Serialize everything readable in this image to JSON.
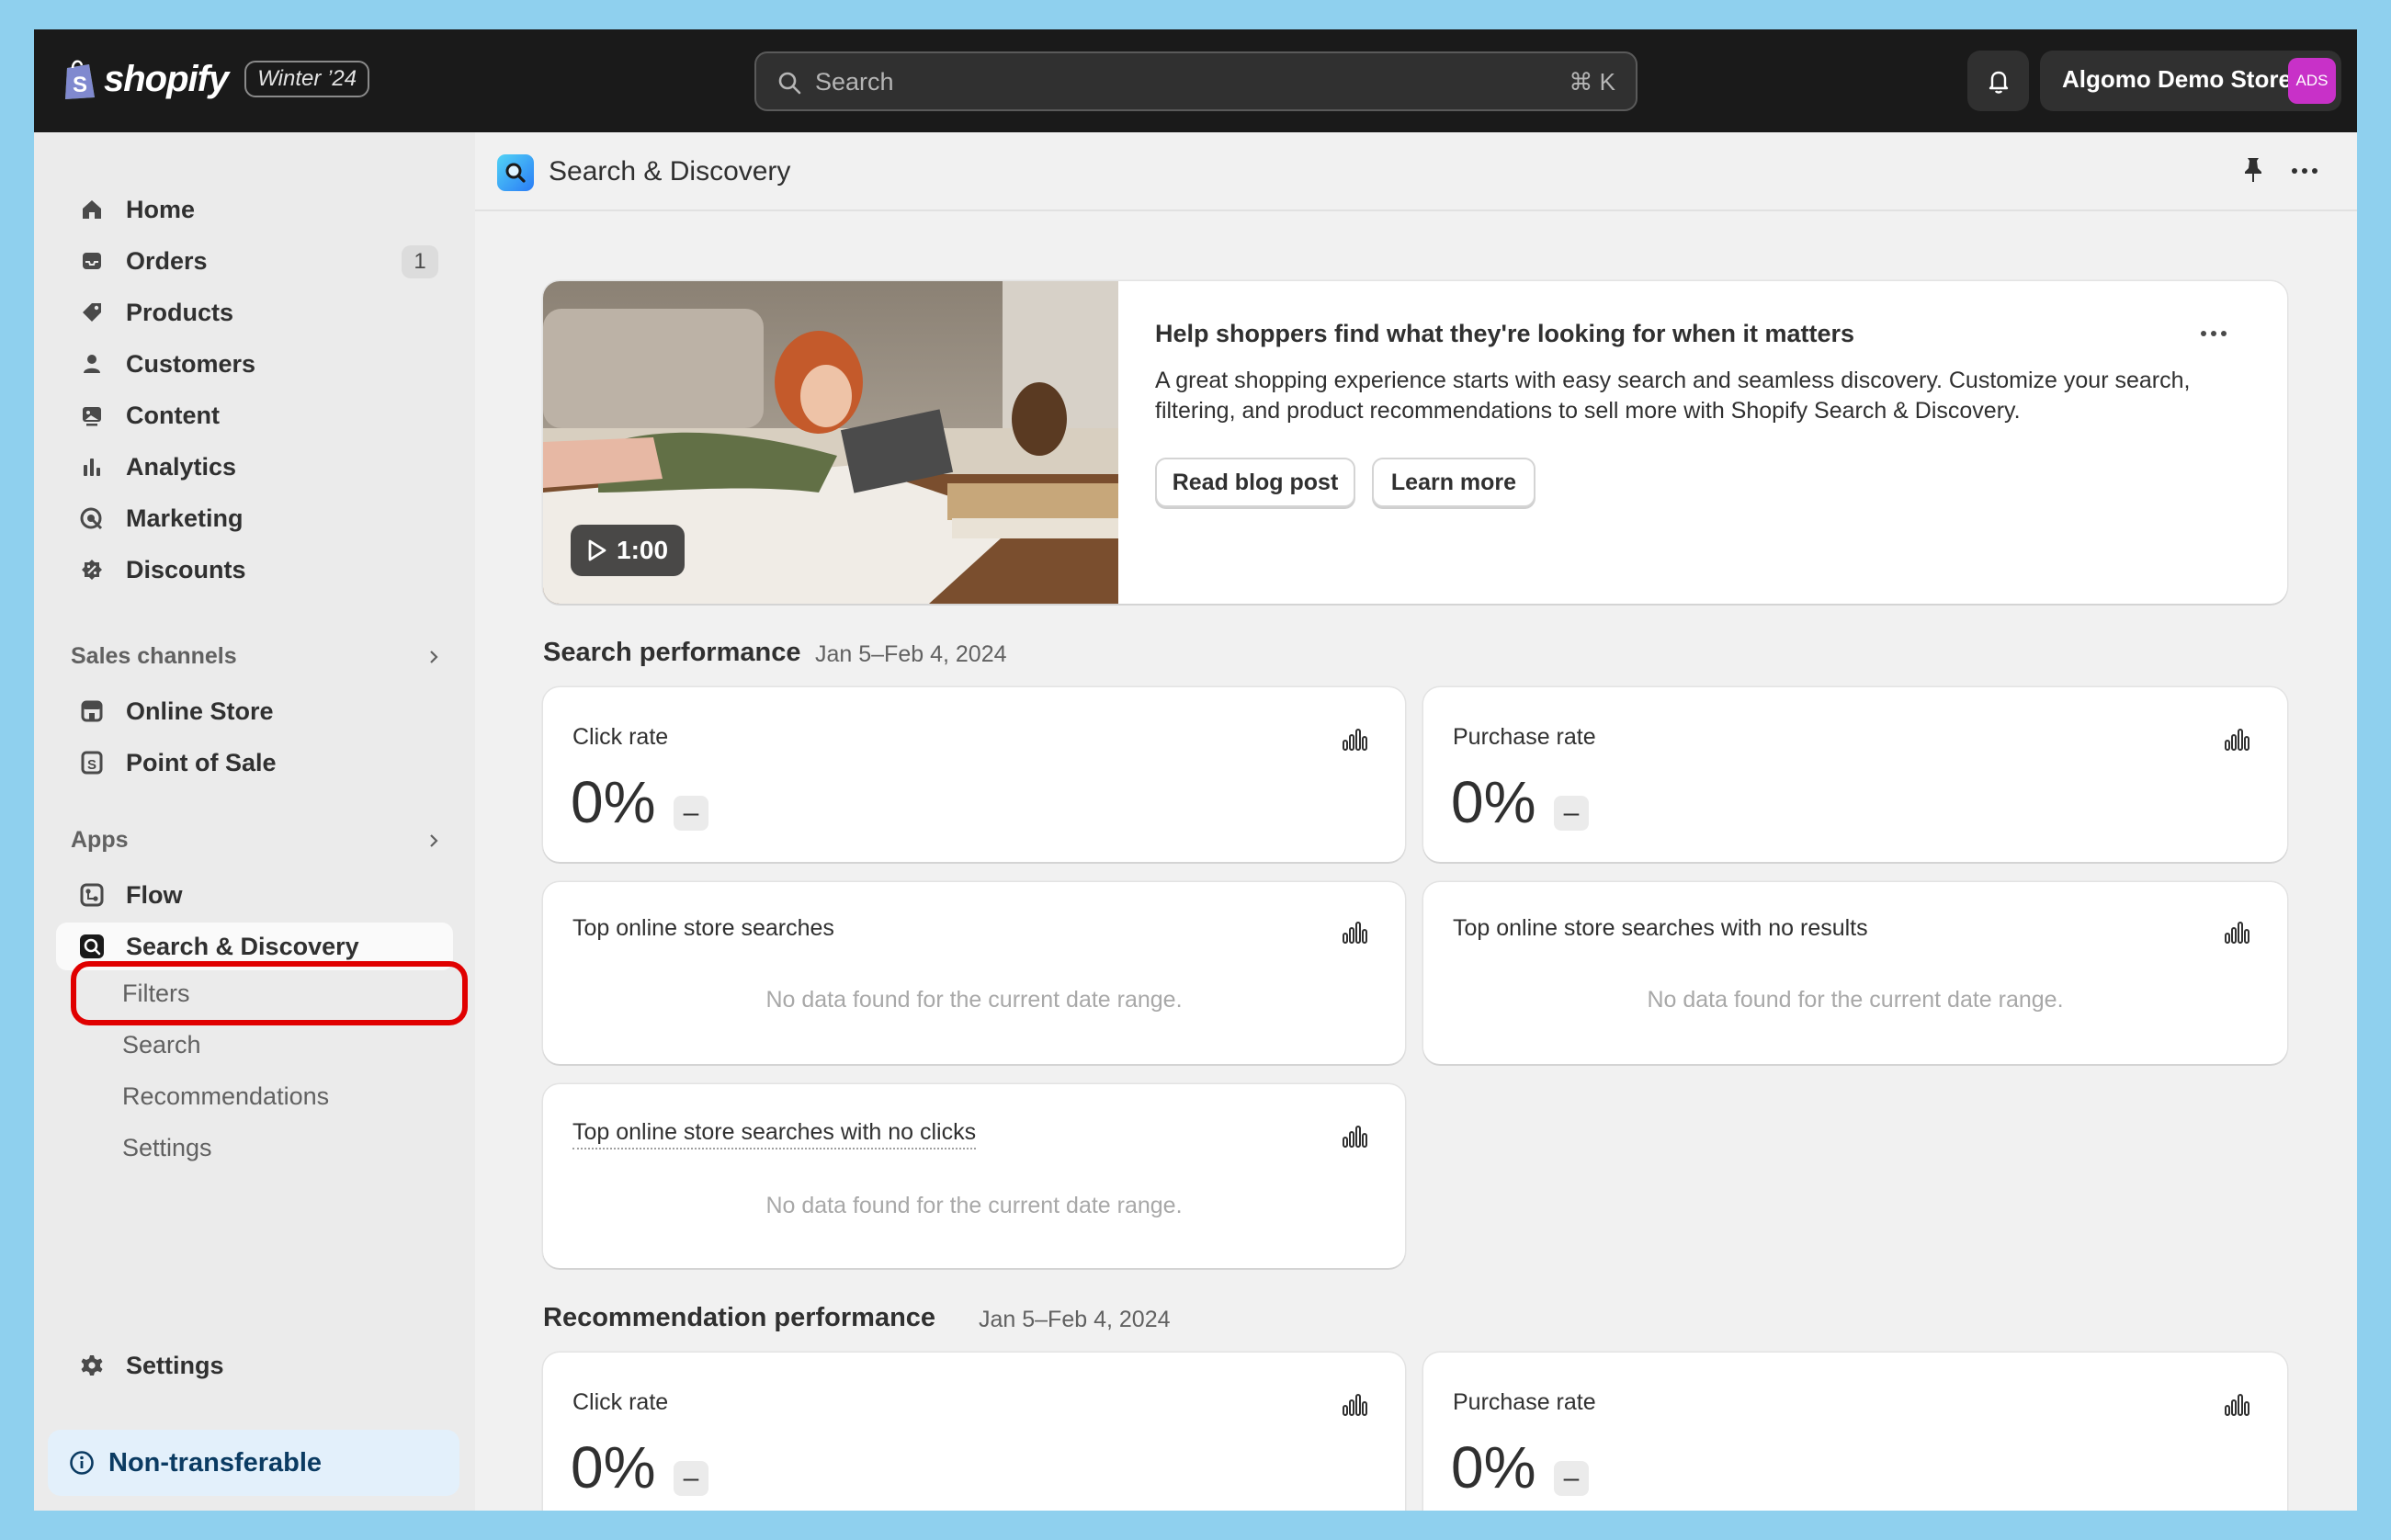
{
  "topbar": {
    "logo_text": "shopify",
    "edition_badge": "Winter ’24",
    "search_placeholder": "Search",
    "search_shortcut": "⌘ K",
    "store_name": "Algomo Demo Store",
    "store_avatar": "ADS",
    "avatar_color": "#c831c8"
  },
  "sidebar": {
    "main_items": [
      {
        "label": "Home",
        "icon": "home-icon"
      },
      {
        "label": "Orders",
        "icon": "inbox-icon",
        "badge": "1"
      },
      {
        "label": "Products",
        "icon": "tag-icon"
      },
      {
        "label": "Customers",
        "icon": "person-icon"
      },
      {
        "label": "Content",
        "icon": "image-icon"
      },
      {
        "label": "Analytics",
        "icon": "bar-chart-icon"
      },
      {
        "label": "Marketing",
        "icon": "target-icon"
      },
      {
        "label": "Discounts",
        "icon": "discount-icon"
      }
    ],
    "sales_channels": {
      "heading": "Sales channels",
      "items": [
        {
          "label": "Online Store",
          "icon": "store-icon"
        },
        {
          "label": "Point of Sale",
          "icon": "pos-icon"
        }
      ]
    },
    "apps": {
      "heading": "Apps",
      "items": [
        {
          "label": "Flow",
          "icon": "flow-icon"
        },
        {
          "label": "Search & Discovery",
          "icon": "search-discovery-icon"
        }
      ],
      "sub_items": [
        "Filters",
        "Search",
        "Recommendations",
        "Settings"
      ]
    },
    "settings_label": "Settings",
    "nontransferable_label": "Non-transferable",
    "highlight_color": "#e00000"
  },
  "header": {
    "title": "Search & Discovery"
  },
  "banner": {
    "video_duration": "1:00",
    "title": "Help shoppers find what they're looking for when it matters",
    "body": "A great shopping experience starts with easy search and seamless discovery. Customize your search, filtering, and product recommendations to sell more with Shopify Search & Discovery.",
    "buttons": [
      "Read blog post",
      "Learn more"
    ]
  },
  "search_performance": {
    "title": "Search performance",
    "date_range": "Jan 5–Feb 4, 2024",
    "metrics": [
      {
        "label": "Click rate",
        "value": "0%",
        "change": "–"
      },
      {
        "label": "Purchase rate",
        "value": "0%",
        "change": "–"
      }
    ],
    "lists": [
      {
        "label": "Top online store searches",
        "empty": "No data found for the current date range."
      },
      {
        "label": "Top online store searches with no results",
        "empty": "No data found for the current date range."
      },
      {
        "label": "Top online store searches with no clicks",
        "empty": "No data found for the current date range."
      }
    ]
  },
  "recommendation_performance": {
    "title": "Recommendation performance",
    "date_range": "Jan 5–Feb 4, 2024",
    "metrics": [
      {
        "label": "Click rate",
        "value": "0%",
        "change": "–"
      },
      {
        "label": "Purchase rate",
        "value": "0%",
        "change": "–"
      }
    ]
  }
}
